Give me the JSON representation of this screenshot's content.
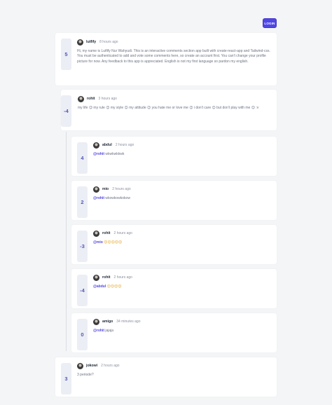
{
  "header": {
    "login_label": "LOGIN"
  },
  "comments": [
    {
      "score": "5",
      "user": "lutfify",
      "time": "8 hours ago",
      "text": "Hi, my name is Lutfify Nur Wahyudi. This is an interactive comments section app built with create-react-app and Tailwind-css. You must be authenticated to add and vote some comments here, so create an account first. You can't change your profile picture for now. Any feedback to this app is appreciated. English is not my first language so pardon my english."
    },
    {
      "score": "-4",
      "user": "rohit",
      "time": "3 hours ago",
      "text": "my life 😉 my rule 😉 my style 😉 my attitude 😉 you hate me or love me 😉 i don't care 😉 but don't play with me 😉 :v",
      "replies": [
        {
          "score": "4",
          "user": "abdul",
          "time": "2 hours ago",
          "mention": "@rohit",
          "text": " wkwkwkkwk"
        },
        {
          "score": "2",
          "user": "mio",
          "time": "2 hours ago",
          "mention": "@rohit",
          "text": " wkowkowkokow"
        },
        {
          "score": "-3",
          "user": "rohit",
          "time": "2 hours ago",
          "mention": "@mio",
          "text": " 😊😊😊😊😊"
        },
        {
          "score": "-4",
          "user": "rohit",
          "time": "2 hours ago",
          "mention": "@abdul",
          "text": " 😊😊😊😊"
        },
        {
          "score": "0",
          "user": "amigo",
          "time": "34 minutes ago",
          "mention": "@rohit",
          "text": " jajaja"
        }
      ]
    },
    {
      "score": "3",
      "user": "jokowi",
      "time": "2 hours ago",
      "text": "3 periode?"
    }
  ]
}
